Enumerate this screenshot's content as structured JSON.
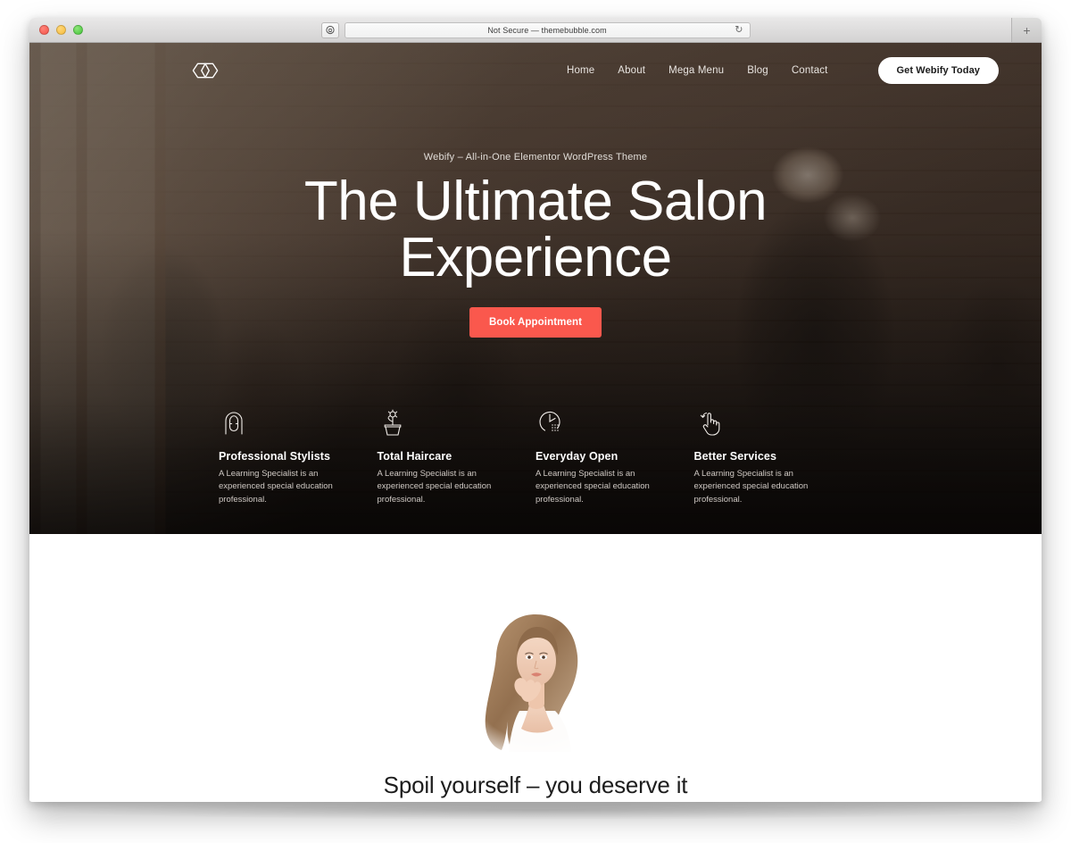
{
  "browser": {
    "url_text": "Not Secure — themebubble.com",
    "shield_icon": "shield-lock-icon",
    "reload_icon": "↻",
    "new_tab_label": "+",
    "traffic_lights": [
      "close-red",
      "minimize-yellow",
      "zoom-green"
    ]
  },
  "site": {
    "logo_name": "webify-logo",
    "nav_items": [
      {
        "label": "Home"
      },
      {
        "label": "About"
      },
      {
        "label": "Mega Menu"
      },
      {
        "label": "Blog"
      },
      {
        "label": "Contact"
      }
    ],
    "nav_cta": "Get Webify Today"
  },
  "hero": {
    "eyebrow": "Webify – All-in-One Elementor WordPress Theme",
    "title_line1": "The Ultimate Salon",
    "title_line2": "Experience",
    "button_label": "Book Appointment",
    "button_color": "#fa584d",
    "background_description": "hair salon interior with stylists and clients"
  },
  "features": [
    {
      "icon": "woman-hair-icon",
      "title": "Professional Stylists",
      "desc": "A Learning Specialist is an experienced special education professional."
    },
    {
      "icon": "potted-flower-icon",
      "title": "Total Haircare",
      "desc": "A Learning Specialist is an experienced special education professional."
    },
    {
      "icon": "clock-icon",
      "title": "Everyday Open",
      "desc": "A Learning Specialist is an experienced special education professional."
    },
    {
      "icon": "hand-refresh-icon",
      "title": "Better Services",
      "desc": "A Learning Specialist is an experienced special education professional."
    }
  ],
  "showcase": {
    "image_name": "woman-long-hair-portrait",
    "heading": "Spoil yourself – you deserve it"
  }
}
